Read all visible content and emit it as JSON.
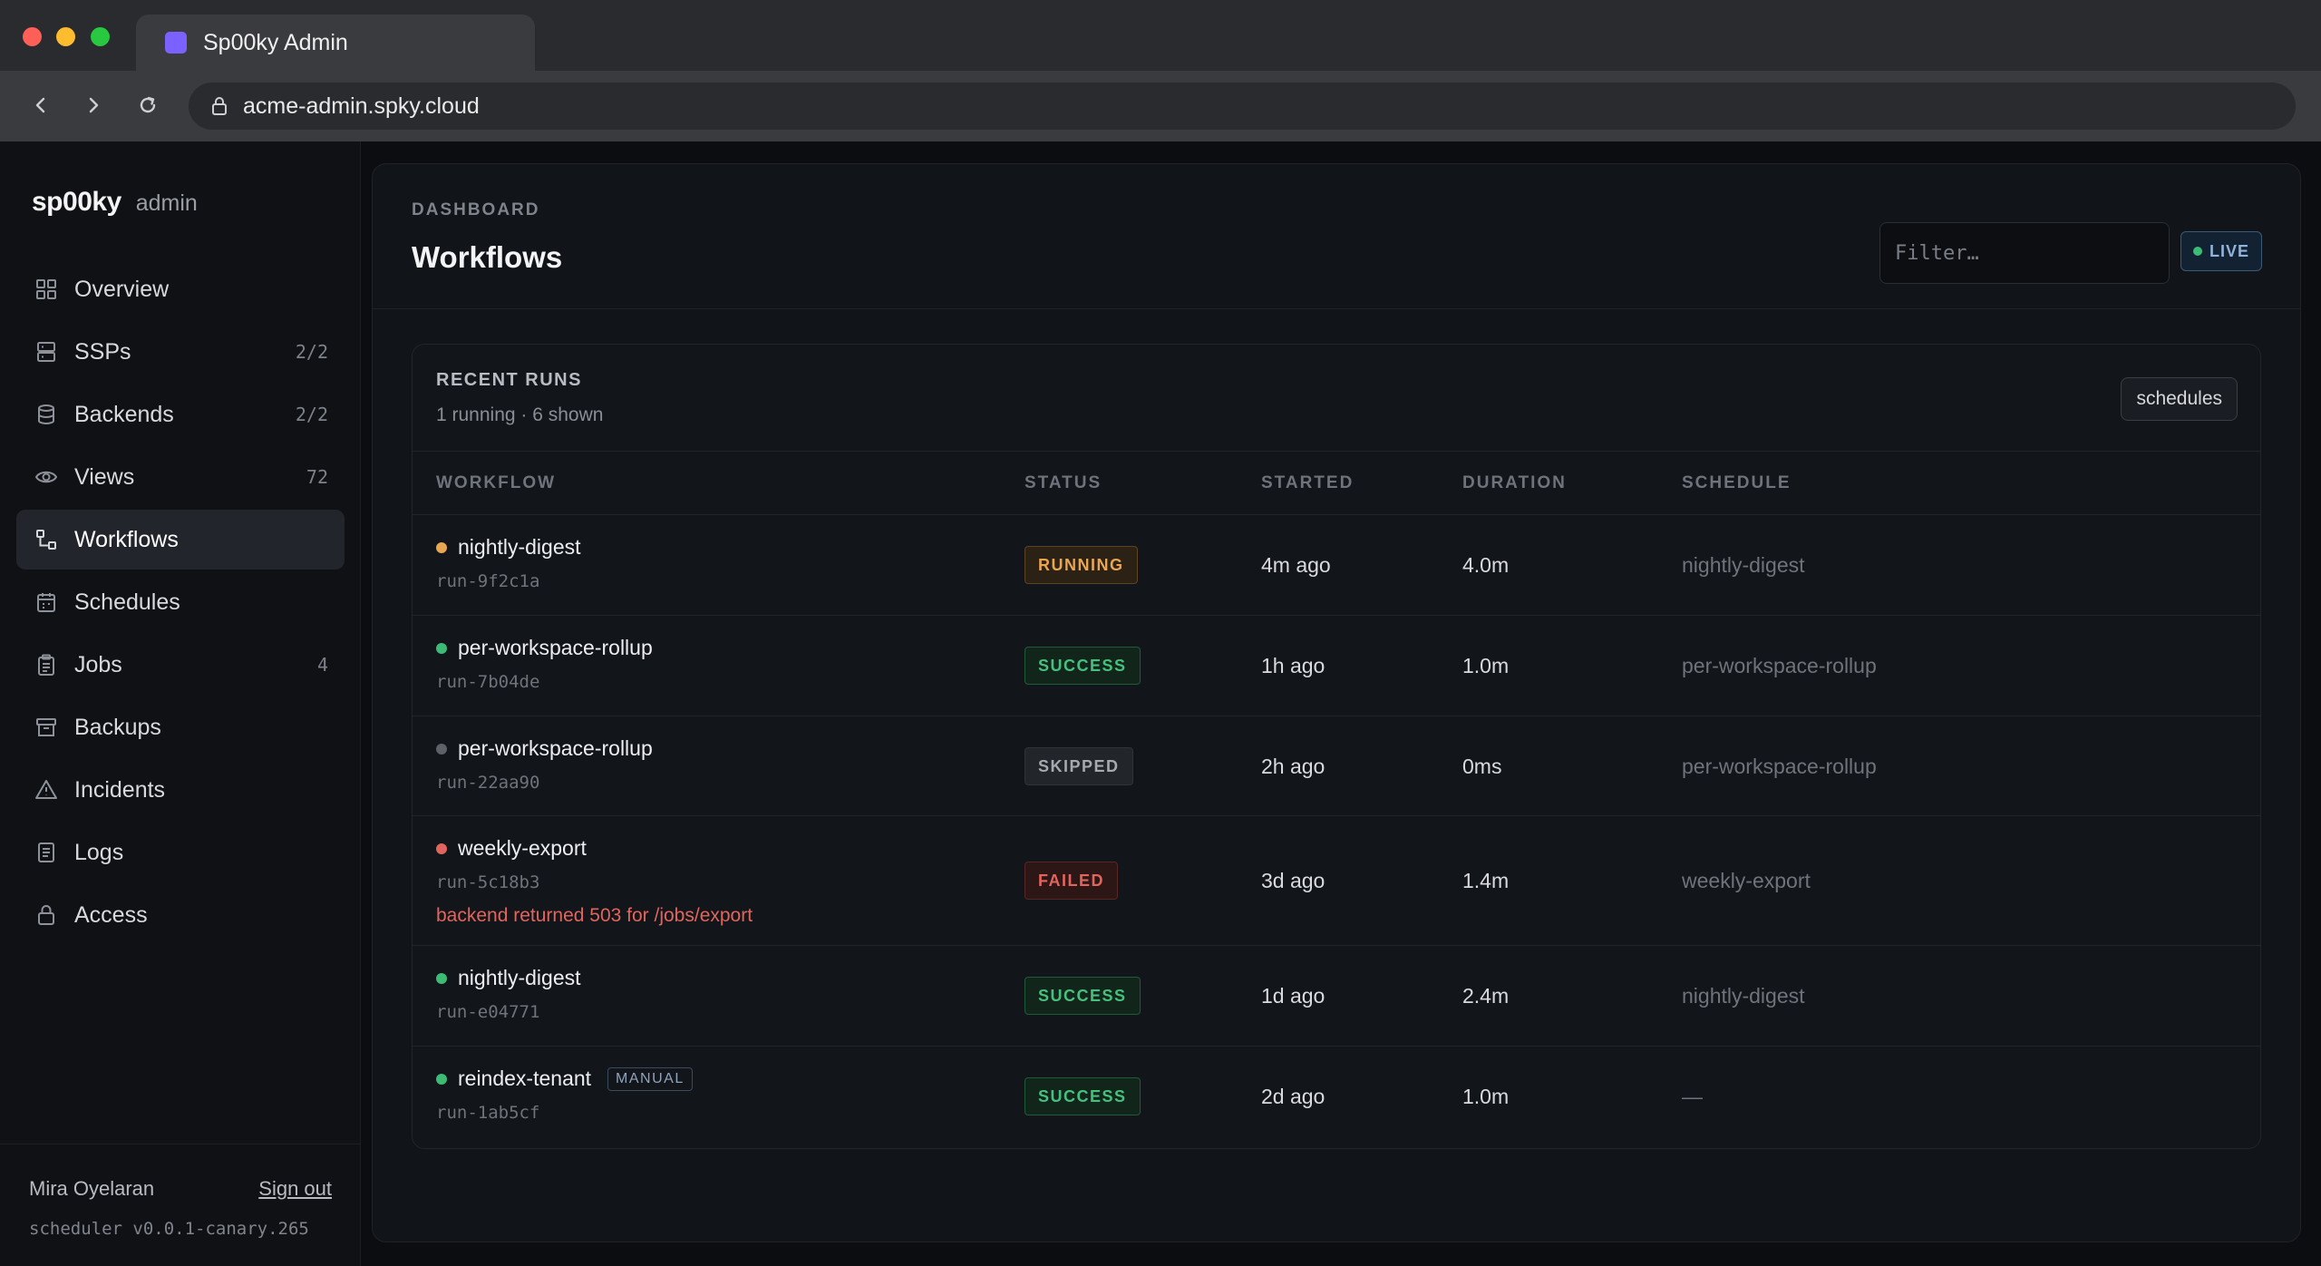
{
  "browser": {
    "tab_title": "Sp00ky Admin",
    "url": "acme-admin.spky.cloud"
  },
  "sidebar": {
    "brand": "sp00ky",
    "brand_sub": "admin",
    "items": [
      {
        "label": "Overview",
        "count": "",
        "icon": "grid-icon"
      },
      {
        "label": "SSPs",
        "count": "2/2",
        "icon": "server-icon"
      },
      {
        "label": "Backends",
        "count": "2/2",
        "icon": "database-icon"
      },
      {
        "label": "Views",
        "count": "72",
        "icon": "eye-icon"
      },
      {
        "label": "Workflows",
        "count": "",
        "icon": "workflow-icon",
        "active": true
      },
      {
        "label": "Schedules",
        "count": "",
        "icon": "calendar-icon"
      },
      {
        "label": "Jobs",
        "count": "4",
        "icon": "clipboard-icon"
      },
      {
        "label": "Backups",
        "count": "",
        "icon": "archive-icon"
      },
      {
        "label": "Incidents",
        "count": "",
        "icon": "warning-icon"
      },
      {
        "label": "Logs",
        "count": "",
        "icon": "document-icon"
      },
      {
        "label": "Access",
        "count": "",
        "icon": "lock-icon"
      }
    ],
    "user": "Mira Oyelaran",
    "signout": "Sign out",
    "version": "scheduler v0.0.1-canary.265"
  },
  "header": {
    "breadcrumb": "DASHBOARD",
    "title": "Workflows",
    "filter_placeholder": "Filter…",
    "live_label": "LIVE"
  },
  "runs": {
    "title": "RECENT RUNS",
    "subtitle": "1 running · 6 shown",
    "schedules_button": "schedules",
    "columns": [
      "WORKFLOW",
      "STATUS",
      "STARTED",
      "DURATION",
      "SCHEDULE"
    ],
    "rows": [
      {
        "name": "nightly-digest",
        "run_id": "run-9f2c1a",
        "status": "RUNNING",
        "started": "4m ago",
        "duration": "4.0m",
        "schedule": "nightly-digest",
        "dot": "#e8a552"
      },
      {
        "name": "per-workspace-rollup",
        "run_id": "run-7b04de",
        "status": "SUCCESS",
        "started": "1h ago",
        "duration": "1.0m",
        "schedule": "per-workspace-rollup",
        "dot": "#3dbb74"
      },
      {
        "name": "per-workspace-rollup",
        "run_id": "run-22aa90",
        "status": "SKIPPED",
        "started": "2h ago",
        "duration": "0ms",
        "schedule": "per-workspace-rollup",
        "dot": "#5d6168"
      },
      {
        "name": "weekly-export",
        "run_id": "run-5c18b3",
        "status": "FAILED",
        "started": "3d ago",
        "duration": "1.4m",
        "schedule": "weekly-export",
        "error": "backend returned 503 for /jobs/export",
        "dot": "#e2655d"
      },
      {
        "name": "nightly-digest",
        "run_id": "run-e04771",
        "status": "SUCCESS",
        "started": "1d ago",
        "duration": "2.4m",
        "schedule": "nightly-digest",
        "dot": "#3dbb74"
      },
      {
        "name": "reindex-tenant",
        "run_id": "run-1ab5cf",
        "status": "SUCCESS",
        "started": "2d ago",
        "duration": "1.0m",
        "schedule": "—",
        "tag": "MANUAL",
        "dot": "#3dbb74"
      }
    ]
  }
}
